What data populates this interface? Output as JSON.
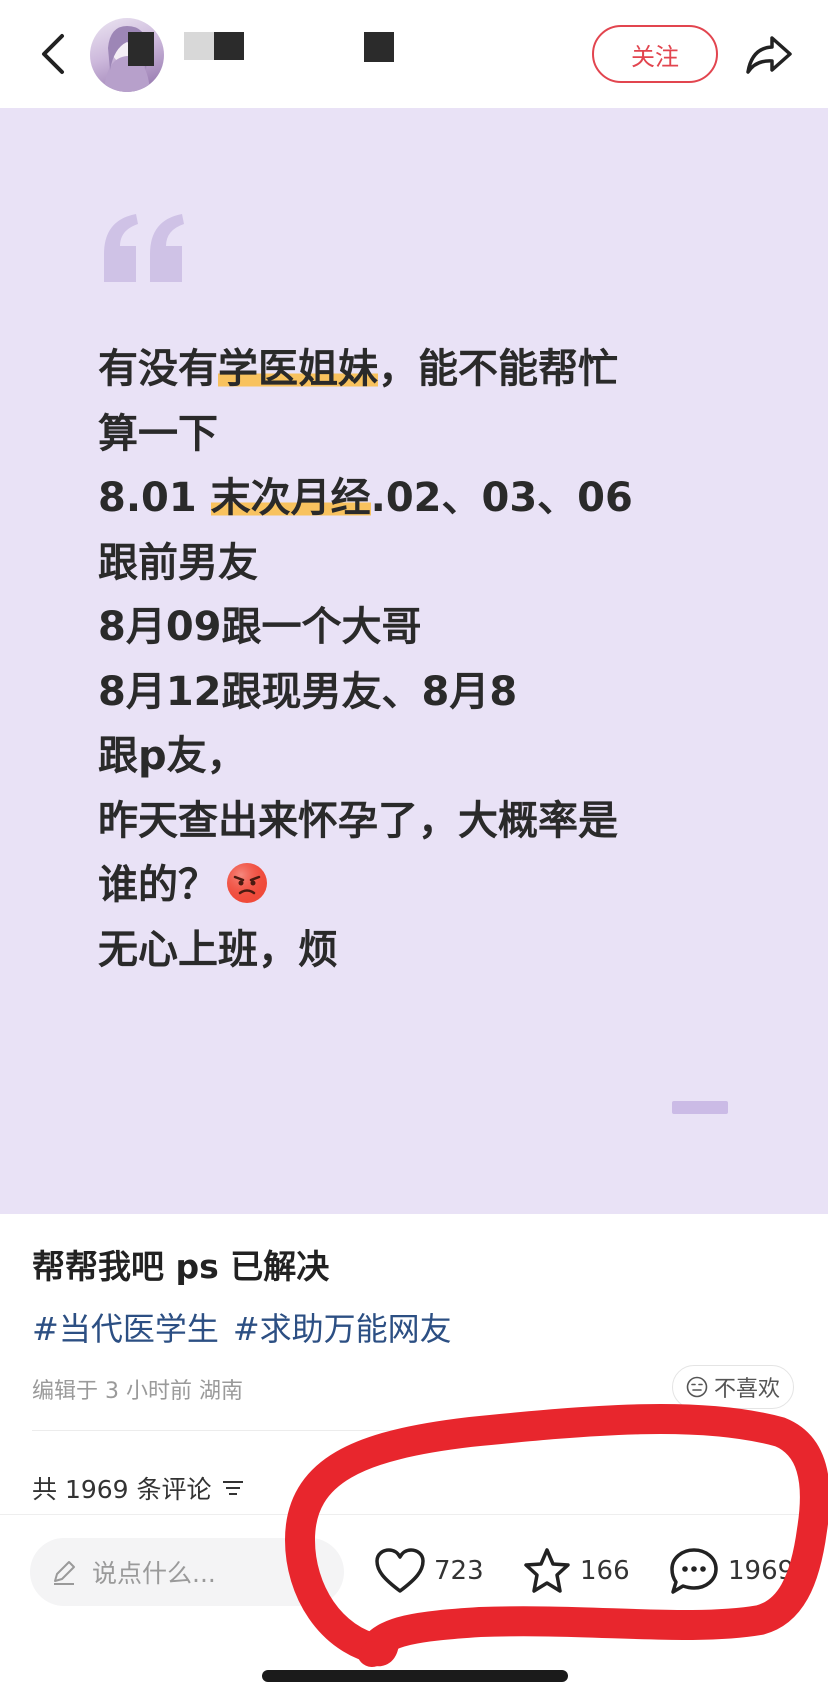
{
  "header": {
    "follow_label": "关注",
    "icons": {
      "back": "chevron-left-icon",
      "share": "share-arrow-icon"
    }
  },
  "card": {
    "text_segments": [
      {
        "text": "有没有",
        "highlight": false
      },
      {
        "text": "学医姐妹",
        "highlight": true
      },
      {
        "text": "，能不能帮忙\n算一下\n8.01 ",
        "highlight": false
      },
      {
        "text": "末次月经",
        "highlight": true
      },
      {
        "text": ".02、03、06\n跟前男友\n8月09跟一个大哥\n8月12跟现男友、8月8\n跟p友，\n昨天查出来怀孕了，大概率是\n谁的？",
        "highlight": false
      }
    ],
    "emoji": "angry-face-emoji",
    "last_line": "无心上班，烦",
    "highlight_color": "#f8c25e",
    "background_color": "#e9e2f6"
  },
  "post": {
    "title": "帮帮我吧 ps 已解决",
    "tags": [
      "#当代医学生",
      "#求助万能网友"
    ],
    "meta": "编辑于 3 小时前 湖南",
    "dislike_label": "不喜欢",
    "comments_header": "共 1969 条评论"
  },
  "bottom_bar": {
    "input_placeholder": "说点什么...",
    "likes": "723",
    "stars": "166",
    "comments": "1969"
  },
  "colors": {
    "accent": "#e2454f",
    "tag": "#2c4f83",
    "marker": "#e8262d"
  }
}
